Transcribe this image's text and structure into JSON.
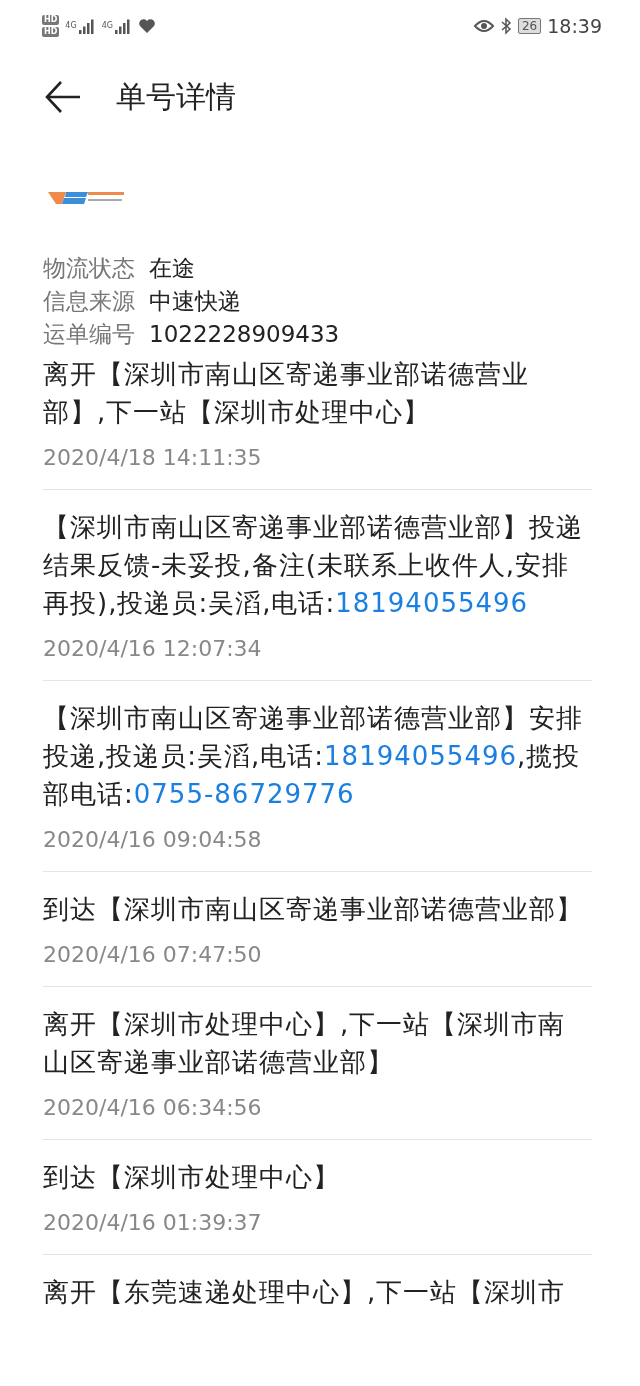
{
  "status_bar": {
    "battery": "26",
    "time": "18:39",
    "sim_labels": [
      "HD",
      "HD"
    ],
    "network": [
      "4G",
      "4G"
    ]
  },
  "header": {
    "title": "单号详情"
  },
  "info": [
    {
      "label": "物流状态",
      "value": "在途"
    },
    {
      "label": "信息来源",
      "value": "中速快递"
    },
    {
      "label": "运单编号",
      "value": "1022228909433"
    }
  ],
  "events": [
    {
      "parts": [
        {
          "kind": "text",
          "text": "离开【深圳市南山区寄递事业部诺德营业部】,下一站【深圳市处理中心】"
        }
      ],
      "time": "2020/4/18 14:11:35"
    },
    {
      "parts": [
        {
          "kind": "text",
          "text": "【深圳市南山区寄递事业部诺德营业部】投递结果反馈-未妥投,备注(未联系上收件人,安排再投),投递员:吴滔,电话:"
        },
        {
          "kind": "phone",
          "text": "18194055496"
        }
      ],
      "time": "2020/4/16 12:07:34"
    },
    {
      "parts": [
        {
          "kind": "text",
          "text": "【深圳市南山区寄递事业部诺德营业部】安排投递,投递员:吴滔,电话:"
        },
        {
          "kind": "phone",
          "text": "18194055496"
        },
        {
          "kind": "text",
          "text": ",揽投部电话:"
        },
        {
          "kind": "phone",
          "text": "0755-86729776"
        }
      ],
      "time": "2020/4/16 09:04:58"
    },
    {
      "parts": [
        {
          "kind": "text",
          "text": "到达【深圳市南山区寄递事业部诺德营业部】"
        }
      ],
      "time": "2020/4/16 07:47:50"
    },
    {
      "parts": [
        {
          "kind": "text",
          "text": "离开【深圳市处理中心】,下一站【深圳市南山区寄递事业部诺德营业部】"
        }
      ],
      "time": "2020/4/16 06:34:56"
    },
    {
      "parts": [
        {
          "kind": "text",
          "text": "到达【深圳市处理中心】"
        }
      ],
      "time": "2020/4/16 01:39:37"
    },
    {
      "parts": [
        {
          "kind": "text",
          "text": "离开【东莞速递处理中心】,下一站【深圳市"
        }
      ]
    }
  ]
}
